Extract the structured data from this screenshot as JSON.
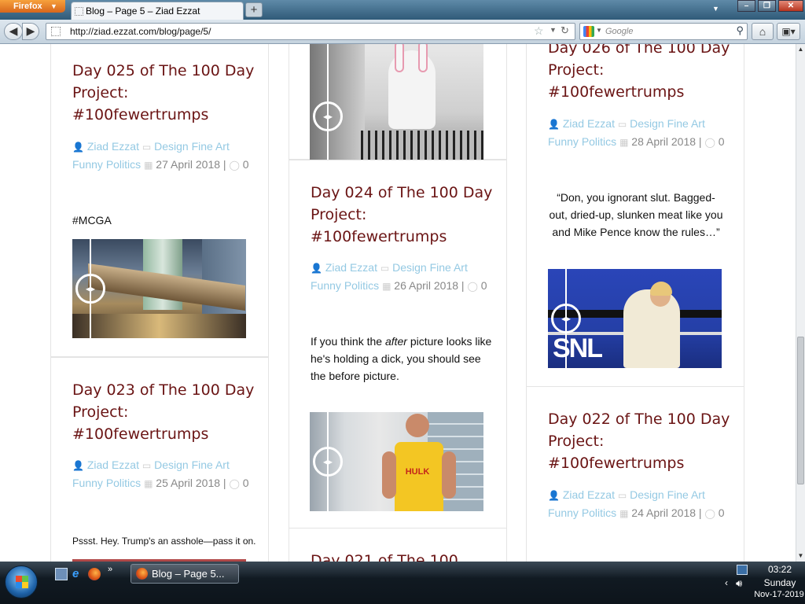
{
  "browser": {
    "menu_label": "Firefox",
    "tab_title": "Blog – Page 5 – Ziad Ezzat",
    "new_tab": "+",
    "url": "http://ziad.ezzat.com/blog/page/5/",
    "search_placeholder": "Google"
  },
  "posts": [
    {
      "title": "Day 025 of The 100 Day Project: #100fewertrumps",
      "author": "Ziad Ezzat",
      "category_1": "Design",
      "category_2": "Fine Art",
      "category_3": "Funny",
      "category_4": "Politics",
      "date": "27 April 2018",
      "comments": "0",
      "excerpt": "#MCGA"
    },
    {
      "title": "Day 023 of The 100 Day Project: #100fewertrumps",
      "author": "Ziad Ezzat",
      "category_1": "Design",
      "category_2": "Fine Art",
      "category_3": "Funny",
      "category_4": "Politics",
      "date": "25 April 2018",
      "comments": "0",
      "excerpt": "Pssst. Hey. Trump's an asshole—pass it on."
    },
    {
      "title": "Day 024 of The 100 Day Project: #100fewertrumps",
      "author": "Ziad Ezzat",
      "category_1": "Design",
      "category_2": "Fine Art",
      "category_3": "Funny",
      "category_4": "Politics",
      "date": "26 April 2018",
      "comments": "0",
      "excerpt_part1": "If you think the ",
      "excerpt_em": "after",
      "excerpt_part2": " picture looks like he's holding a dick, you should see the before picture."
    },
    {
      "title": "Day 021 of The 100"
    },
    {
      "title": "Day 026 of The 100 Day Project: #100fewertrumps",
      "author": "Ziad Ezzat",
      "category_1": "Design",
      "category_2": "Fine Art",
      "category_3": "Funny",
      "category_4": "Politics",
      "date": "28 April 2018",
      "comments": "0",
      "excerpt": "“Don, you ignorant slut. Bagged-out, dried-up, slunken meat like you and Mike Pence know the rules…”"
    },
    {
      "title": "Day 022 of The 100 Day Project: #100fewertrumps",
      "author": "Ziad Ezzat",
      "category_1": "Design",
      "category_2": "Fine Art",
      "category_3": "Funny",
      "category_4": "Politics",
      "date": "24 April 2018",
      "comments": "0"
    }
  ],
  "snl_logo": "SNL",
  "taskbar": {
    "task_label": "Blog – Page 5...",
    "time": "03:22",
    "day": "Sunday",
    "date": "Nov-17-2019"
  },
  "colors": {
    "title": "#6a1414",
    "meta_link": "#94c9e3",
    "meta_text": "#888888"
  }
}
